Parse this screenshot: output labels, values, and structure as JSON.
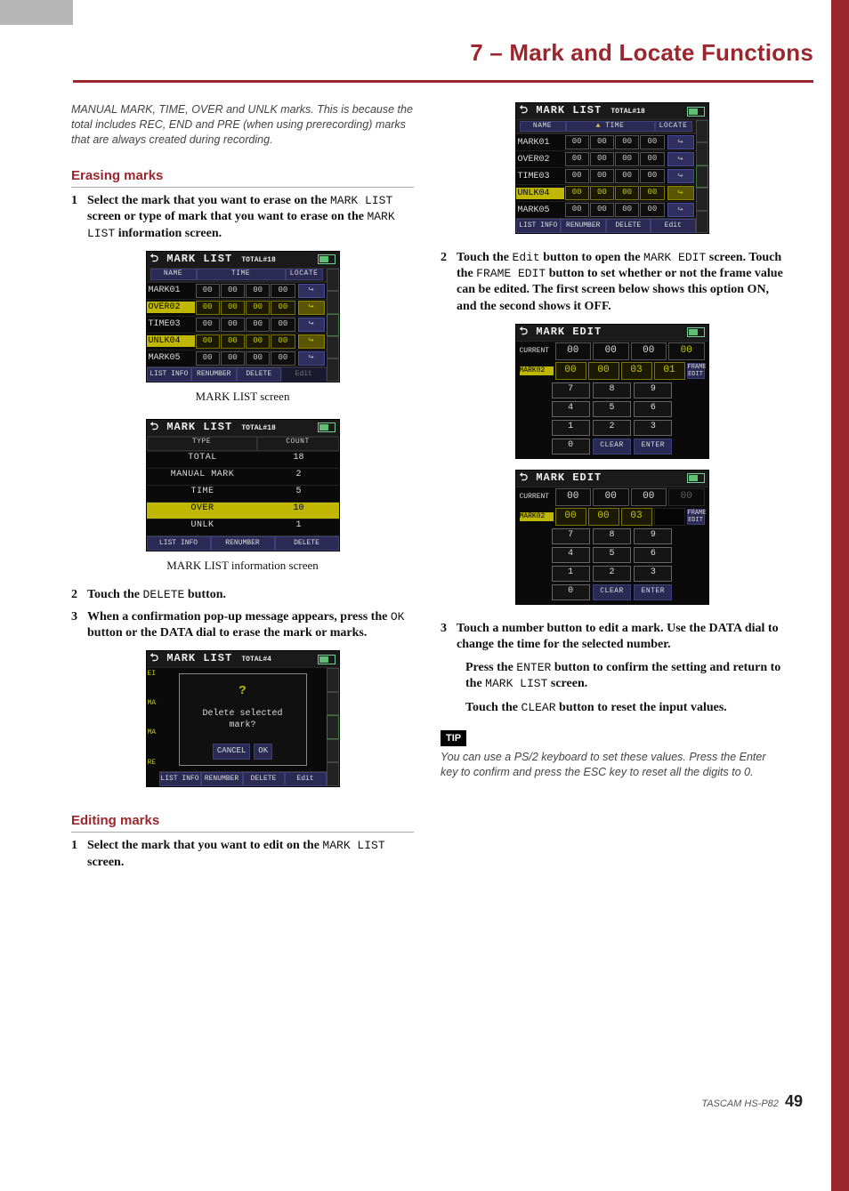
{
  "header": {
    "title": "7 – Mark and Locate Functions"
  },
  "intro_note": "MANUAL MARK, TIME, OVER and UNLK marks. This is because the total includes REC, END and PRE (when using prerecording) marks that are always created during recording.",
  "sections": {
    "erasing": {
      "heading": "Erasing marks",
      "step1_a": "Select the mark that you want to erase on the ",
      "step1_code1": "MARK LIST",
      "step1_b": " screen or type of mark that you want to erase on the ",
      "step1_code2": "MARK LIST",
      "step1_c": " information screen.",
      "caption_marklist": "MARK LIST screen",
      "caption_info": "MARK LIST information screen",
      "step2_a": "Touch the ",
      "step2_code": "DELETE",
      "step2_b": " button.",
      "step3_a": "When a confirmation pop-up message appears, press the ",
      "step3_code": "OK",
      "step3_b": " button or the DATA dial to erase the mark or marks."
    },
    "editing": {
      "heading": "Editing marks",
      "step1_a": "Select the mark that you want to edit on the ",
      "step1_code": "MARK LIST",
      "step1_b": " screen.",
      "step2_a": "Touch the ",
      "step2_code1": "Edit",
      "step2_b": " button to open the ",
      "step2_code2": "MARK EDIT",
      "step2_c": " screen. Touch the ",
      "step2_code3": "FRAME EDIT",
      "step2_d": " button to set whether or not the frame value can be edited. The first screen below shows this option ON, and the second shows it OFF.",
      "step3_a": "Touch a number button to edit a mark. Use the DATA dial to change the time for the selected number.",
      "step3_ind1_a": "Press the ",
      "step3_ind1_code1": "ENTER",
      "step3_ind1_b": " button to confirm the setting and return to the ",
      "step3_ind1_code2": "MARK LIST",
      "step3_ind1_c": " screen.",
      "step3_ind2_a": "Touch the ",
      "step3_ind2_code": "CLEAR",
      "step3_ind2_b": " button to reset the input values."
    },
    "tip": {
      "label": "TIP",
      "text": "You can use a PS/2 keyboard to set these values. Press the Enter key to confirm and press the ESC key to reset all the digits to 0."
    }
  },
  "lcd": {
    "marklist": {
      "title": "MARK LIST",
      "total_label": "TOTAL#18",
      "cols": {
        "name": "NAME",
        "time": "TIME",
        "locate": "LOCATE"
      },
      "rows": [
        {
          "name": "MARK01",
          "time": [
            "00",
            "00",
            "00",
            "00"
          ],
          "sel": false
        },
        {
          "name": "OVER02",
          "time": [
            "00",
            "00",
            "00",
            "00"
          ],
          "sel": true
        },
        {
          "name": "TIME03",
          "time": [
            "00",
            "00",
            "00",
            "00"
          ],
          "sel": false
        },
        {
          "name": "UNLK04",
          "time": [
            "00",
            "00",
            "00",
            "00"
          ],
          "sel": true
        },
        {
          "name": "MARK05",
          "time": [
            "00",
            "00",
            "00",
            "00"
          ],
          "sel": false
        }
      ],
      "foot": {
        "listinfo": "LIST\nINFO",
        "renumber": "RENUMBER",
        "delete": "DELETE",
        "edit": "Edit"
      }
    },
    "marklist_info": {
      "title": "MARK LIST",
      "total_label": "TOTAL#18",
      "thead": {
        "type": "TYPE",
        "count": "COUNT"
      },
      "rows": [
        {
          "type": "TOTAL",
          "count": "18",
          "sel": false
        },
        {
          "type": "MANUAL MARK",
          "count": "2",
          "sel": false
        },
        {
          "type": "TIME",
          "count": "5",
          "sel": false
        },
        {
          "type": "OVER",
          "count": "10",
          "sel": true
        },
        {
          "type": "UNLK",
          "count": "1",
          "sel": false
        }
      ],
      "foot": {
        "listinfo": "LIST\nINFO",
        "renumber": "RENUMBER",
        "delete": "DELETE"
      }
    },
    "dialog": {
      "title": "MARK LIST",
      "total_label": "TOTAL#4",
      "msg": "Delete selected mark?",
      "cancel": "CANCEL",
      "ok": "OK",
      "side_items": [
        "EI",
        "MA",
        "MA",
        "RE"
      ]
    },
    "markedit_on": {
      "title": "MARK EDIT",
      "current_label": "CURRENT",
      "mark_label": "MARK02",
      "current": [
        "00",
        "00",
        "00",
        "00"
      ],
      "mark": [
        "00",
        "00",
        "03",
        "01"
      ],
      "frame_btn": "FRAME\nEDIT",
      "keys": [
        "7",
        "8",
        "9",
        "4",
        "5",
        "6",
        "1",
        "2",
        "3",
        "0",
        "CLEAR",
        "ENTER"
      ]
    },
    "markedit_off": {
      "title": "MARK EDIT",
      "current_label": "CURRENT",
      "mark_label": "MARK02",
      "current": [
        "00",
        "00",
        "00",
        "00"
      ],
      "mark": [
        "00",
        "00",
        "03",
        ""
      ],
      "frame_btn": "FRAME\nEDIT",
      "keys": [
        "7",
        "8",
        "9",
        "4",
        "5",
        "6",
        "1",
        "2",
        "3",
        "0",
        "CLEAR",
        "ENTER"
      ]
    }
  },
  "footer": {
    "brand": "TASCAM HS-P82",
    "page": "49"
  }
}
